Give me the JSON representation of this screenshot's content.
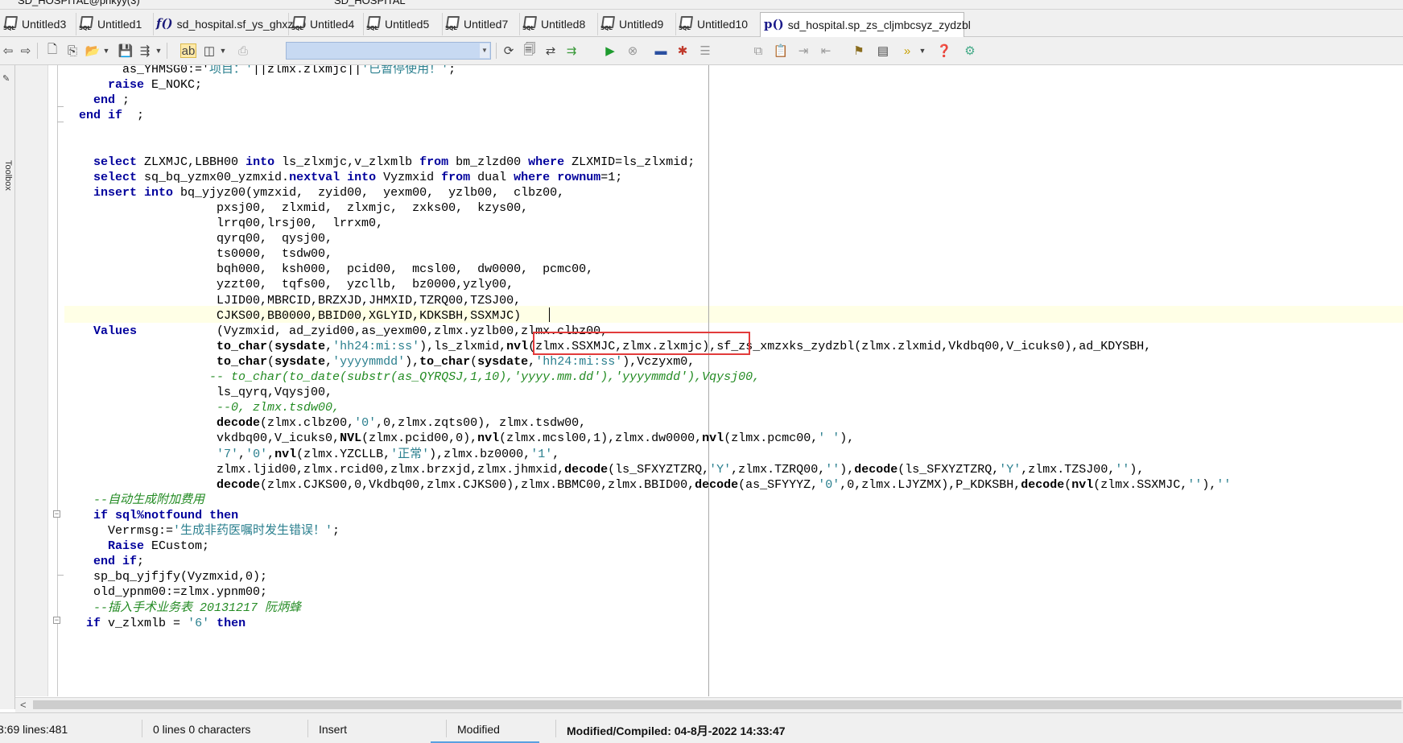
{
  "window": {
    "title": "SD_HOSPITAL@pnkyy(3)",
    "title2": "SD_HOSPITAL"
  },
  "tabs": [
    {
      "label": "Untitled3",
      "icon": "sql-icon"
    },
    {
      "label": "Untitled1",
      "icon": "sql-icon"
    },
    {
      "label": "sd_hospital.sf_ys_ghxz00",
      "icon": "function-icon"
    },
    {
      "label": "Untitled4",
      "icon": "sql-icon"
    },
    {
      "label": "Untitled5",
      "icon": "sql-icon"
    },
    {
      "label": "Untitled7",
      "icon": "sql-icon"
    },
    {
      "label": "Untitled8",
      "icon": "sql-icon"
    },
    {
      "label": "Untitled9",
      "icon": "sql-icon"
    },
    {
      "label": "Untitled10",
      "icon": "sql-icon"
    },
    {
      "label": "sd_hospital.sp_zs_cljmbcsyz_zydzbl",
      "icon": "procedure-icon"
    }
  ],
  "icon_text": {
    "function": "f()",
    "procedure": "p()"
  },
  "toolbar": {
    "object_combo_value": ""
  },
  "sidebar": {
    "toolbox_label": "Toolbox"
  },
  "editor": {
    "lines": [
      [
        [
          "t",
          "        as_YHMSG0:='"
        ],
        [
          "s",
          "项目：'"
        ],
        [
          "t",
          "||zlmx.zlxmjc||"
        ],
        [
          "s",
          "'已暂停使用！'"
        ],
        [
          "t",
          ";"
        ]
      ],
      [
        [
          "t",
          "      "
        ],
        [
          "k",
          "raise"
        ],
        [
          "t",
          " E_NOKC;"
        ]
      ],
      [
        [
          "t",
          "    "
        ],
        [
          "k",
          "end"
        ],
        [
          "t",
          " ;"
        ]
      ],
      [
        [
          "t",
          "  "
        ],
        [
          "k",
          "end if"
        ],
        [
          "t",
          "  ;"
        ]
      ],
      [],
      [],
      [
        [
          "t",
          "    "
        ],
        [
          "k",
          "select"
        ],
        [
          "t",
          " ZLXMJC,LBBH00 "
        ],
        [
          "k",
          "into"
        ],
        [
          "t",
          " ls_zlxmjc,v_zlxmlb "
        ],
        [
          "k",
          "from"
        ],
        [
          "t",
          " bm_zlzd00 "
        ],
        [
          "k",
          "where"
        ],
        [
          "t",
          " ZLXMID=ls_zlxmid;"
        ]
      ],
      [
        [
          "t",
          "    "
        ],
        [
          "k",
          "select"
        ],
        [
          "t",
          " sq_bq_yzmx00_yzmxid."
        ],
        [
          "k",
          "nextval"
        ],
        [
          "t",
          " "
        ],
        [
          "k",
          "into"
        ],
        [
          "t",
          " Vyzmxid "
        ],
        [
          "k",
          "from"
        ],
        [
          "t",
          " dual "
        ],
        [
          "k",
          "where"
        ],
        [
          "t",
          " "
        ],
        [
          "k",
          "rownum"
        ],
        [
          "t",
          "=1;"
        ]
      ],
      [
        [
          "t",
          "    "
        ],
        [
          "k",
          "insert into"
        ],
        [
          "t",
          " bq_yjyz00(ymzxid,  zyid00,  yexm00,  yzlb00,  clbz00,"
        ]
      ],
      [
        [
          "t",
          "                     pxsj00,  zlxmid,  zlxmjc,  zxks00,  kzys00,"
        ]
      ],
      [
        [
          "t",
          "                     lrrq00,lrsj00,  lrrxm0,"
        ]
      ],
      [
        [
          "t",
          "                     qyrq00,  qysj00,"
        ]
      ],
      [
        [
          "t",
          "                     ts0000,  tsdw00,"
        ]
      ],
      [
        [
          "t",
          "                     bqh000,  ksh000,  pcid00,  mcsl00,  dw0000,  pcmc00,"
        ]
      ],
      [
        [
          "t",
          "                     yzzt00,  tqfs00,  yzcllb,  bz0000,yzly00,"
        ]
      ],
      [
        [
          "t",
          "                     LJID00,MBRCID,BRZXJD,JHMXID,TZRQ00,TZSJ00,"
        ]
      ],
      [
        [
          "t",
          "                     CJKS00,BB0000,BBID00,XGLYID,KDKSBH,SSXMJC)"
        ]
      ],
      [
        [
          "t",
          "    "
        ],
        [
          "k",
          "Values"
        ],
        [
          "t",
          "           (Vyzmxid, ad_zyid00,as_yexm00,zlmx.yzlb00,zlmx.clbz00,"
        ]
      ],
      [
        [
          "t",
          "                     "
        ],
        [
          "f",
          "to_char"
        ],
        [
          "t",
          "("
        ],
        [
          "f",
          "sysdate"
        ],
        [
          "t",
          ","
        ],
        [
          "s",
          "'hh24:mi:ss'"
        ],
        [
          "t",
          "),ls_zlxmid,"
        ],
        [
          "f",
          "nvl"
        ],
        [
          "t",
          "(zlmx.SSXMJC,zlmx.zlxmjc),sf_zs_xmzxks_zydzbl(zlmx.zlxmid,Vkdbq00,V_icuks0),ad_KDYSBH,"
        ]
      ],
      [
        [
          "t",
          "                     "
        ],
        [
          "f",
          "to_char"
        ],
        [
          "t",
          "("
        ],
        [
          "f",
          "sysdate"
        ],
        [
          "t",
          ","
        ],
        [
          "s",
          "'yyyymmdd'"
        ],
        [
          "t",
          "),"
        ],
        [
          "f",
          "to_char"
        ],
        [
          "t",
          "("
        ],
        [
          "f",
          "sysdate"
        ],
        [
          "t",
          ","
        ],
        [
          "s",
          "'hh24:mi:ss'"
        ],
        [
          "t",
          "),Vczyxm0,"
        ]
      ],
      [
        [
          "t",
          "                    "
        ],
        [
          "c",
          "-- to_char(to_date(substr(as_QYRQSJ,1,10),'yyyy.mm.dd'),'yyyymmdd'),Vqysj00,"
        ]
      ],
      [
        [
          "t",
          "                     ls_qyrq,Vqysj00,"
        ]
      ],
      [
        [
          "t",
          "                     "
        ],
        [
          "c",
          "--0, zlmx.tsdw00,"
        ]
      ],
      [
        [
          "t",
          "                     "
        ],
        [
          "f",
          "decode"
        ],
        [
          "t",
          "(zlmx.clbz00,"
        ],
        [
          "s",
          "'0'"
        ],
        [
          "t",
          ",0,zlmx.zqts00), zlmx.tsdw00,"
        ]
      ],
      [
        [
          "t",
          "                     vkdbq00,V_icuks0,"
        ],
        [
          "f",
          "NVL"
        ],
        [
          "t",
          "(zlmx.pcid00,0),"
        ],
        [
          "f",
          "nvl"
        ],
        [
          "t",
          "(zlmx.mcsl00,1),zlmx.dw0000,"
        ],
        [
          "f",
          "nvl"
        ],
        [
          "t",
          "(zlmx.pcmc00,"
        ],
        [
          "s",
          "' '"
        ],
        [
          "t",
          "),"
        ]
      ],
      [
        [
          "t",
          "                     "
        ],
        [
          "s",
          "'7'"
        ],
        [
          "t",
          ","
        ],
        [
          "s",
          "'0'"
        ],
        [
          "t",
          ","
        ],
        [
          "f",
          "nvl"
        ],
        [
          "t",
          "(zlmx.YZCLLB,"
        ],
        [
          "s",
          "'正常'"
        ],
        [
          "t",
          "),zlmx.bz0000,"
        ],
        [
          "s",
          "'1'"
        ],
        [
          "t",
          ","
        ]
      ],
      [
        [
          "t",
          "                     zlmx.ljid00,zlmx.rcid00,zlmx.brzxjd,zlmx.jhmxid,"
        ],
        [
          "f",
          "decode"
        ],
        [
          "t",
          "(ls_SFXYZTZRQ,"
        ],
        [
          "s",
          "'Y'"
        ],
        [
          "t",
          ",zlmx.TZRQ00,"
        ],
        [
          "s",
          "''"
        ],
        [
          "t",
          "),"
        ],
        [
          "f",
          "decode"
        ],
        [
          "t",
          "(ls_SFXYZTZRQ,"
        ],
        [
          "s",
          "'Y'"
        ],
        [
          "t",
          ",zlmx.TZSJ00,"
        ],
        [
          "s",
          "''"
        ],
        [
          "t",
          "),"
        ]
      ],
      [
        [
          "t",
          "                     "
        ],
        [
          "f",
          "decode"
        ],
        [
          "t",
          "(zlmx.CJKS00,0,Vkdbq00,zlmx.CJKS00),zlmx.BBMC00,zlmx.BBID00,"
        ],
        [
          "f",
          "decode"
        ],
        [
          "t",
          "(as_SFYYYZ,"
        ],
        [
          "s",
          "'0'"
        ],
        [
          "t",
          ",0,zlmx.LJYZMX),P_KDKSBH,"
        ],
        [
          "f",
          "decode"
        ],
        [
          "t",
          "("
        ],
        [
          "f",
          "nvl"
        ],
        [
          "t",
          "(zlmx.SSXMJC,"
        ],
        [
          "s",
          "''"
        ],
        [
          "t",
          "),"
        ],
        [
          "s",
          "''"
        ]
      ],
      [
        [
          "t",
          "    "
        ],
        [
          "c",
          "--自动生成附加费用"
        ]
      ],
      [
        [
          "t",
          "    "
        ],
        [
          "k",
          "if"
        ],
        [
          "t",
          " "
        ],
        [
          "k",
          "sql%notfound"
        ],
        [
          "t",
          " "
        ],
        [
          "k",
          "then"
        ]
      ],
      [
        [
          "t",
          "      Verrmsg:="
        ],
        [
          "s",
          "'生成非药医嘱时发生错误！'"
        ],
        [
          "t",
          ";"
        ]
      ],
      [
        [
          "t",
          "      "
        ],
        [
          "k",
          "Raise"
        ],
        [
          "t",
          " ECustom;"
        ]
      ],
      [
        [
          "t",
          "    "
        ],
        [
          "k",
          "end if"
        ],
        [
          "t",
          ";"
        ]
      ],
      [
        [
          "t",
          "    sp_bq_yjfjfy(Vyzmxid,0);"
        ]
      ],
      [
        [
          "t",
          "    old_ypnm00:=zlmx.ypnm00;"
        ]
      ],
      [
        [
          "t",
          "    "
        ],
        [
          "c",
          "--插入手术业务表 20131217 阮炳蜂"
        ]
      ],
      [
        [
          "t",
          "   "
        ],
        [
          "k",
          "if"
        ],
        [
          "t",
          " v_zlxmlb = "
        ],
        [
          "s",
          "'6'"
        ],
        [
          "t",
          " "
        ],
        [
          "k",
          "then"
        ]
      ]
    ]
  },
  "statusbar": {
    "position": "3:69 lines:481",
    "selection": "0 lines 0 characters",
    "mode": "Insert",
    "state": "Modified",
    "compiled": "Modified/Compiled: 04-8月-2022 14:33:47"
  }
}
